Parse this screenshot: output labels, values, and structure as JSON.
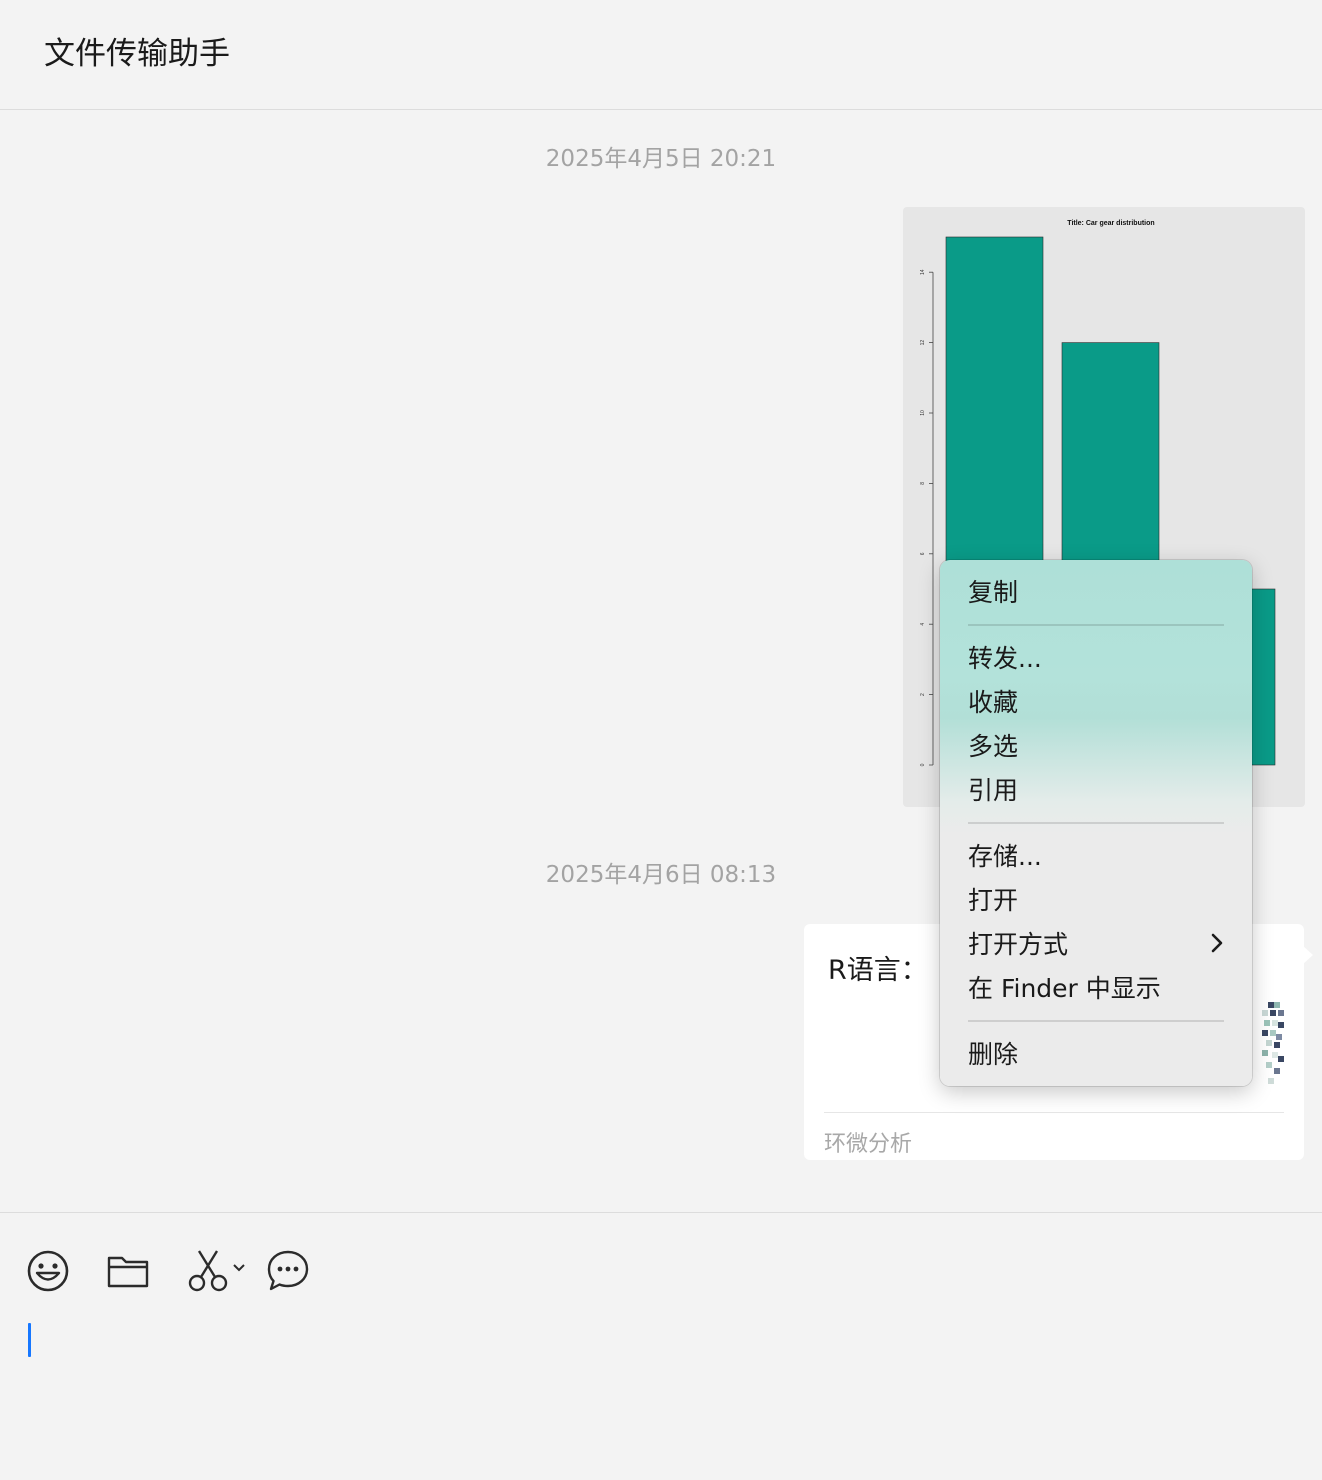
{
  "window": {
    "title": "文件传输助手"
  },
  "messages": {
    "timestamp_1": "2025年4月5日 20:21",
    "timestamp_2": "2025年4月6日 08:13",
    "image_message": {
      "chart_data": {
        "type": "bar",
        "title": "Title: Car gear distribution",
        "xlabel": "",
        "ylabel": "",
        "categories": [
          "",
          "",
          ""
        ],
        "values": [
          15,
          12,
          5
        ],
        "ylim": [
          0,
          15
        ],
        "yticks": [
          "0",
          "2",
          "4",
          "6",
          "8",
          "10",
          "12",
          "14"
        ],
        "bar_color": "#0a9b88",
        "background": "#e6e6e6",
        "grid": false
      }
    },
    "link_card": {
      "title": "R语言：",
      "source": "环微分析"
    }
  },
  "context_menu": {
    "items": [
      {
        "label": "复制"
      },
      {
        "label": "转发..."
      },
      {
        "label": "收藏"
      },
      {
        "label": "多选"
      },
      {
        "label": "引用"
      },
      {
        "label": "存储..."
      },
      {
        "label": "打开"
      },
      {
        "label": "打开方式",
        "submenu_icon": "chevron-right-icon"
      },
      {
        "label": "在 Finder 中显示"
      },
      {
        "label": "删除"
      }
    ]
  },
  "toolbar": {
    "icons": [
      "emoji-icon",
      "folder-icon",
      "scissors-icon",
      "chat-bubble-icon"
    ]
  },
  "colors": {
    "accent": "#1677ff",
    "bar": "#0a9b88"
  }
}
